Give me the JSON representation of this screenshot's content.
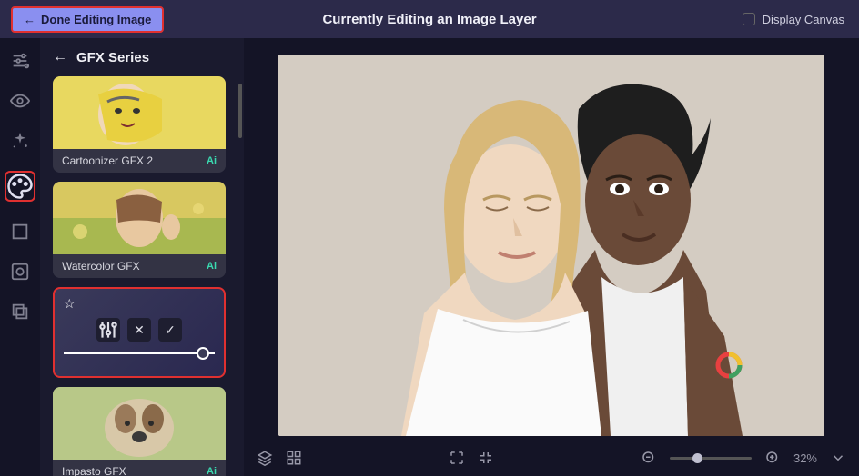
{
  "topbar": {
    "done_label": "Done Editing Image",
    "title": "Currently Editing an Image Layer",
    "display_canvas_label": "Display Canvas"
  },
  "rail": {
    "items": [
      {
        "name": "adjust-icon"
      },
      {
        "name": "eye-icon"
      },
      {
        "name": "sparkle-icon"
      },
      {
        "name": "palette-icon",
        "active": true
      },
      {
        "name": "crop-icon"
      },
      {
        "name": "texture-icon"
      },
      {
        "name": "overlay-icon"
      }
    ]
  },
  "panel": {
    "title": "GFX Series",
    "cards": [
      {
        "label": "Cartoonizer GFX 2",
        "ai": "Ai"
      },
      {
        "label": "Watercolor GFX",
        "ai": "Ai"
      },
      {
        "label": "Impasto GFX",
        "ai": "Ai"
      }
    ],
    "slider_value": 90
  },
  "bottom": {
    "zoom_pct": "32%"
  }
}
